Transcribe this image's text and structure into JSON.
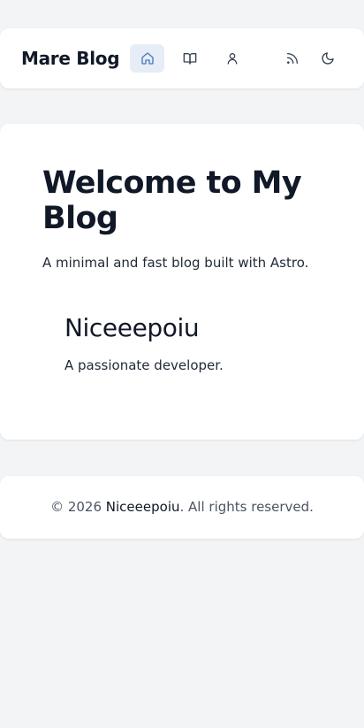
{
  "header": {
    "brand": "Mare Blog",
    "nav": [
      {
        "icon": "home-icon",
        "active": true
      },
      {
        "icon": "book-open-icon",
        "active": false
      },
      {
        "icon": "user-icon",
        "active": false
      }
    ],
    "actions": [
      {
        "icon": "rss-icon"
      },
      {
        "icon": "moon-icon"
      }
    ]
  },
  "main": {
    "title": "Welcome to My Blog",
    "subtitle": "A minimal and fast blog built with Astro.",
    "author": {
      "name": "Niceeepoiu",
      "bio": "A passionate developer."
    }
  },
  "footer": {
    "prefix": "© 2026 ",
    "link_text": "Niceeepoiu",
    "suffix": ". All rights reserved."
  },
  "colors": {
    "page_background": "#f3f4f6",
    "card_background": "#ffffff",
    "accent": "#4a78b8",
    "active_nav_background": "#e6edf6",
    "text_primary": "#111827",
    "text_muted": "#4b5563"
  }
}
